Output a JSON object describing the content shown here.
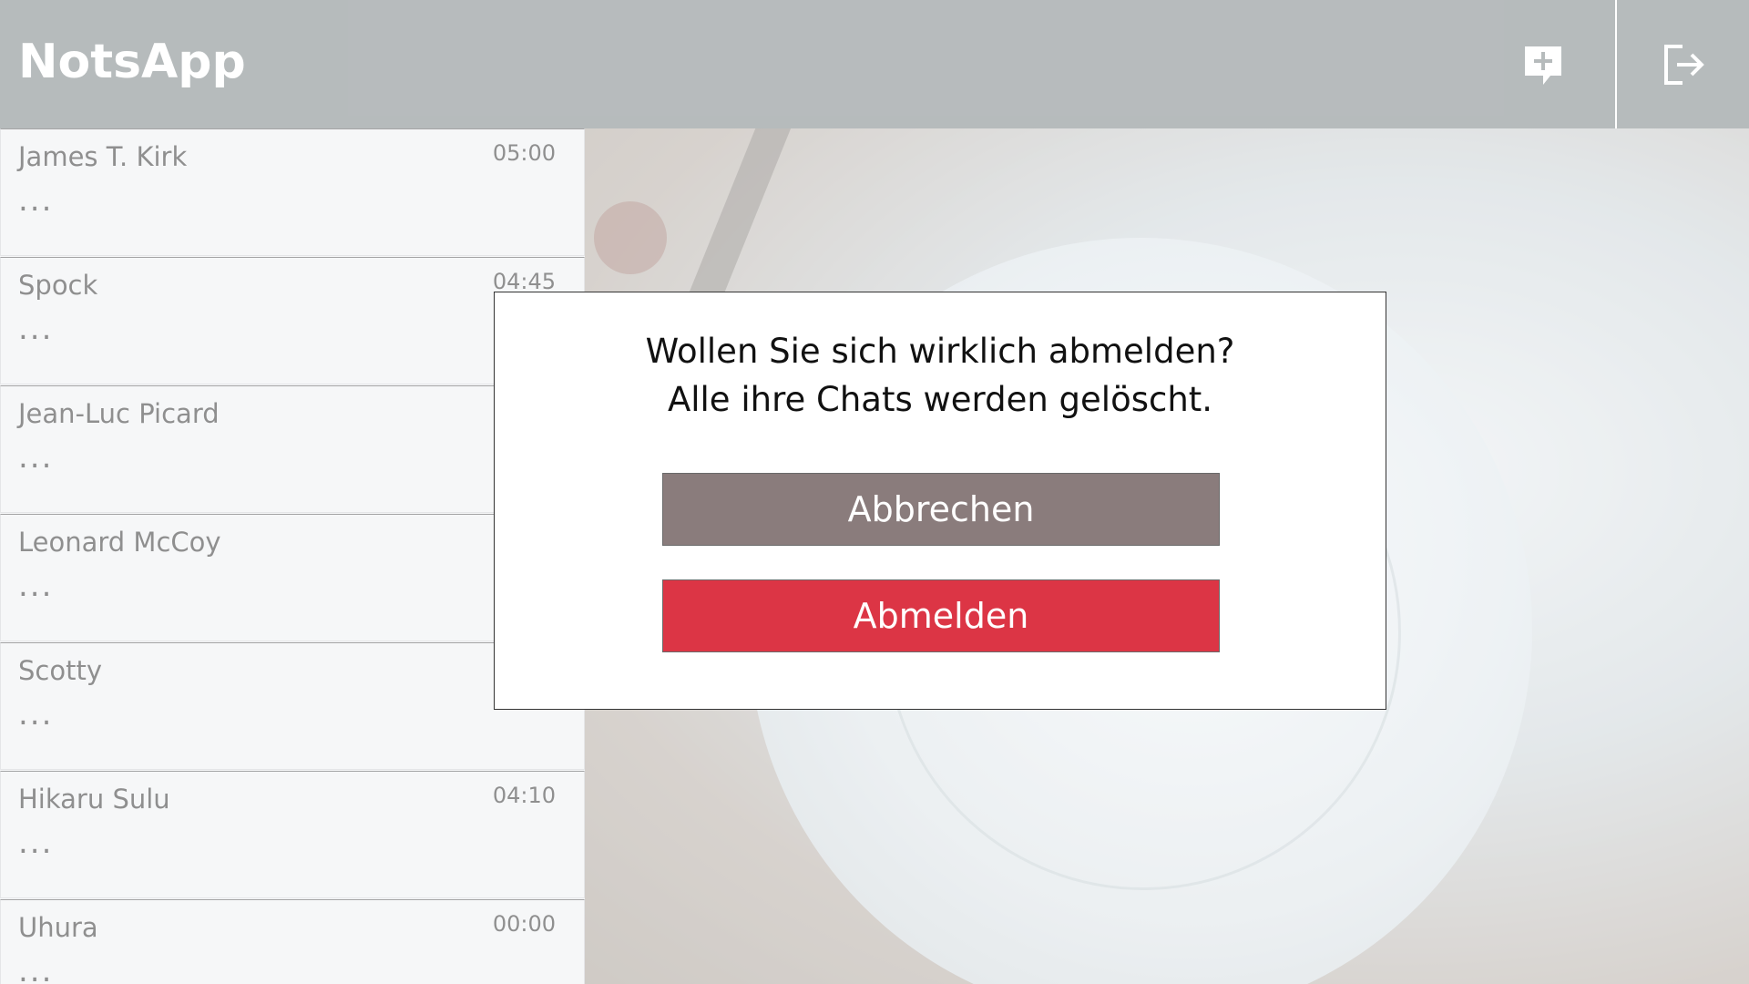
{
  "app": {
    "title": "NotsApp"
  },
  "header": {
    "new_chat_icon": "chat-plus-icon",
    "logout_icon": "logout-icon"
  },
  "chats": [
    {
      "name": "James T. Kirk",
      "time": "05:00",
      "preview": "..."
    },
    {
      "name": "Spock",
      "time": "04:45",
      "preview": "..."
    },
    {
      "name": "Jean-Luc Picard",
      "time": "",
      "preview": "..."
    },
    {
      "name": "Leonard McCoy",
      "time": "",
      "preview": "..."
    },
    {
      "name": "Scotty",
      "time": "",
      "preview": "..."
    },
    {
      "name": "Hikaru Sulu",
      "time": "04:10",
      "preview": "..."
    },
    {
      "name": "Uhura",
      "time": "00:00",
      "preview": "..."
    }
  ],
  "dialog": {
    "line1": "Wollen Sie sich wirklich abmelden?",
    "line2": "Alle ihre Chats werden gelöscht.",
    "cancel_label": "Abbrechen",
    "confirm_label": "Abmelden"
  },
  "colors": {
    "header": "#b3b8ba",
    "cancel": "#8a7c7c",
    "confirm": "#dc3545"
  }
}
